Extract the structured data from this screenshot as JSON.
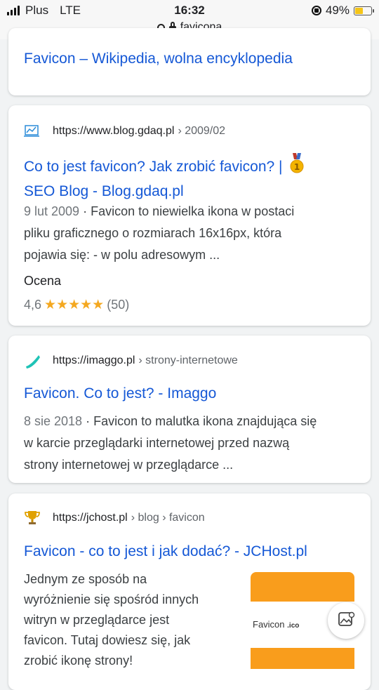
{
  "status_bar": {
    "carrier": "Plus",
    "network": "LTE",
    "time": "16:32",
    "battery": "49%",
    "battery_level": 0.49
  },
  "address_bar": {
    "query": "favicona"
  },
  "results": [
    {
      "title": "Favicon – Wikipedia, wolna encyklopedia"
    },
    {
      "favicon": "chart-icon",
      "url": "https://www.blog.gdaq.pl",
      "crumb": "› 2009/02",
      "title_line1": "Co to jest favicon? Jak zrobić favicon? |",
      "title_line2": "SEO Blog - Blog.gdaq.pl",
      "title_icon": "medal-icon",
      "date": "9 lut 2009",
      "snippet_line1": " · Favicon to niewielka ikona w postaci",
      "snippet_line2": "pliku graficznego o rozmiarach 16x16px, która",
      "snippet_line3": "pojawia się: - w polu adresowym ...",
      "rating_label": "Ocena",
      "rating_value": "4,6",
      "rating_stars": "★★★★★",
      "rating_count": "(50)",
      "rating_numeric": 4.6
    },
    {
      "favicon": "imaggo-logo-icon",
      "url": "https://imaggo.pl",
      "crumb": "› strony-internetowe",
      "title": "Favicon. Co to jest? - Imaggo",
      "date": "8 sie 2018",
      "snippet_line1": " · Favicon to malutka ikona znajdująca się",
      "snippet_line2": "w karcie przeglądarki internetowej przed nazwą",
      "snippet_line3": "strony internetowej w przeglądarce ..."
    },
    {
      "favicon": "trophy-icon",
      "url": "https://jchost.pl",
      "crumb": "› blog › favicon",
      "title": "Favicon - co to jest i jak dodać? - JCHost.pl",
      "snippet_line1": "Jednym ze sposób na",
      "snippet_line2": "wyróżnienie się spośród innych",
      "snippet_line3": "witryn w przeglądarce jest",
      "snippet_line4": "favicon. Tutaj dowiesz się, jak",
      "snippet_line5": "zrobić ikonę strony!",
      "thumbnail_text": "Favicon",
      "thumbnail_ext": ".ico"
    }
  ],
  "colors": {
    "link": "#1558d6",
    "star": "#f4a820",
    "thumb_orange": "#f99d1c",
    "imaggo_teal": "#1fc3b6"
  }
}
